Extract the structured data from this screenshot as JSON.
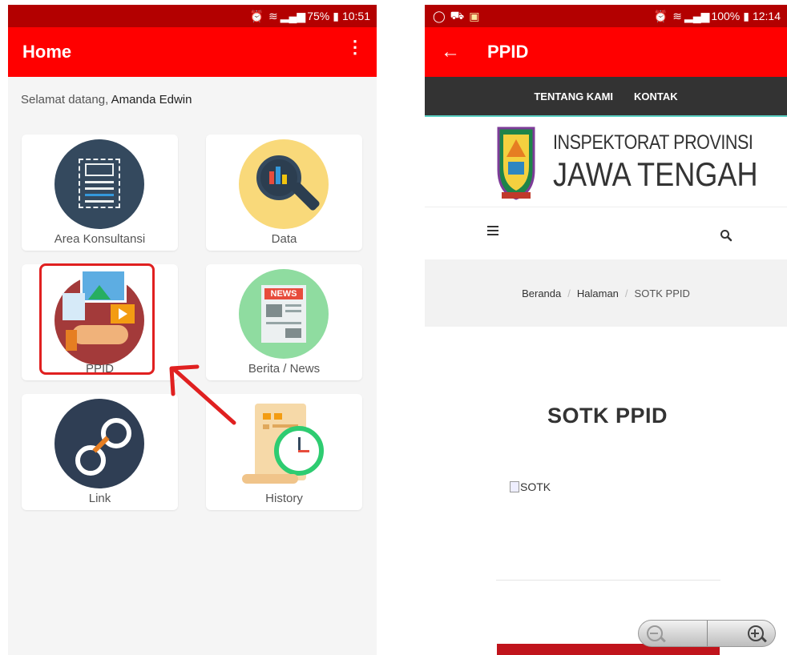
{
  "left_phone": {
    "status": {
      "alarm_icon": "alarm-icon",
      "wifi_icon": "wifi-icon",
      "signal_icon": "signal-icon",
      "battery": "75%",
      "time": "10:51"
    },
    "appbar": {
      "title": "Home",
      "menu_icon": "more-vert-icon"
    },
    "welcome_prefix": "Selamat datang,",
    "welcome_name": "Amanda Edwin",
    "tiles": [
      {
        "label": "Area Konsultansi",
        "icon": "consultation-icon",
        "color": "#34495e"
      },
      {
        "label": "Data",
        "icon": "data-search-icon",
        "color": "#f9d97a"
      },
      {
        "label": "PPID",
        "icon": "ppid-media-icon",
        "color": "#a33a3a"
      },
      {
        "label": "Berita / News",
        "icon": "news-icon",
        "color": "#8fdca0"
      },
      {
        "label": "Link",
        "icon": "link-icon",
        "color": "#2f3e54"
      },
      {
        "label": "History",
        "icon": "history-icon",
        "color": "#ffffff"
      }
    ],
    "highlight_color": "#e02020"
  },
  "right_phone": {
    "status": {
      "whatsapp_icon": "whatsapp-icon",
      "car_icon": "car-icon",
      "gallery_icon": "gallery-icon",
      "battery": "100%",
      "time": "12:14"
    },
    "appbar": {
      "back_icon": "arrow-back-icon",
      "title": "PPID"
    },
    "topnav": [
      "TENTANG KAMI",
      "KONTAK"
    ],
    "logo_line1": "INSPEKTORAT PROVINSI",
    "logo_line2": "JAWA TENGAH",
    "breadcrumb": [
      "Beranda",
      "Halaman",
      "SOTK PPID"
    ],
    "breadcrumb_sep": "/",
    "page_title": "SOTK PPID",
    "image_alt": "SOTK",
    "zoom_out_icon": "zoom-out-icon",
    "zoom_in_icon": "zoom-in-icon"
  }
}
